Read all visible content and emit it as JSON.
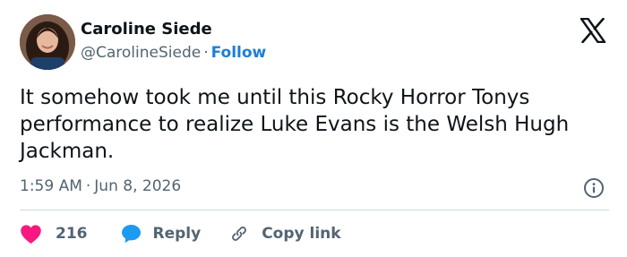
{
  "author": {
    "name": "Caroline Siede",
    "handle": "@CarolineSiede",
    "separator": "·",
    "follow_label": "Follow"
  },
  "tweet": {
    "text": "It somehow took me until this Rocky Horror Tonys performance to realize Luke Evans is the Welsh Hugh Jackman.",
    "time": "1:59 AM",
    "date": "Jun 8, 2026",
    "separator": "·"
  },
  "actions": {
    "likes_count": "216",
    "reply_label": "Reply",
    "copy_link_label": "Copy link"
  },
  "icons": {
    "logo": "x-logo-icon",
    "info": "info-icon",
    "like": "heart-icon",
    "reply": "speech-bubble-icon",
    "copy": "link-icon"
  },
  "colors": {
    "text": "#0f1419",
    "muted": "#536471",
    "follow": "#1d7fd3",
    "heart": "#f91880",
    "reply_bubble": "#1d9bf0",
    "divider": "#cfd9de"
  }
}
